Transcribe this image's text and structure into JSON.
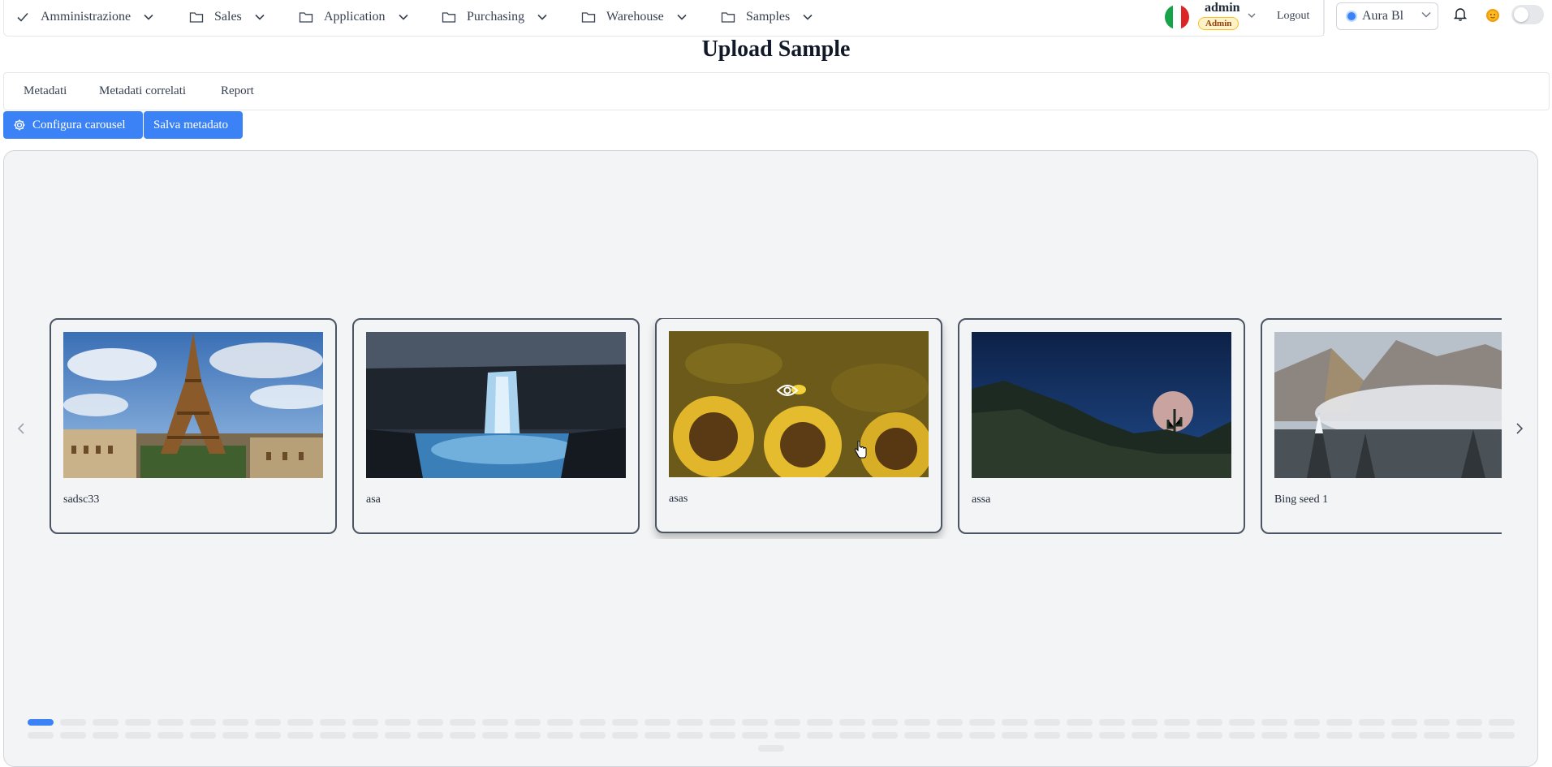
{
  "menu": [
    {
      "label": "Amministrazione",
      "icon": "check-icon"
    },
    {
      "label": "Sales",
      "icon": "folder-icon"
    },
    {
      "label": "Application",
      "icon": "folder-icon"
    },
    {
      "label": "Purchasing",
      "icon": "folder-icon"
    },
    {
      "label": "Warehouse",
      "icon": "folder-icon"
    },
    {
      "label": "Samples",
      "icon": "folder-icon"
    }
  ],
  "user": {
    "name": "admin",
    "role": "Admin",
    "logout": "Logout"
  },
  "theme": {
    "label": "Aura Bl",
    "accent": "#3b82f6"
  },
  "page": {
    "title": "Upload Sample"
  },
  "tabs": [
    "Metadati",
    "Metadati correlati",
    "Report"
  ],
  "actions": {
    "configure": "Configura carousel",
    "save": "Salva metadato"
  },
  "carousel": {
    "items": [
      {
        "label": "sadsc33",
        "image": "eiffel-tower"
      },
      {
        "label": "asa",
        "image": "waterfall"
      },
      {
        "label": "asas",
        "image": "sunflowers"
      },
      {
        "label": "assa",
        "image": "moon-desert"
      },
      {
        "label": "Bing seed 1",
        "image": "snowy-valley"
      }
    ],
    "active_index": 2,
    "page_count": 93,
    "current_page": 1
  }
}
